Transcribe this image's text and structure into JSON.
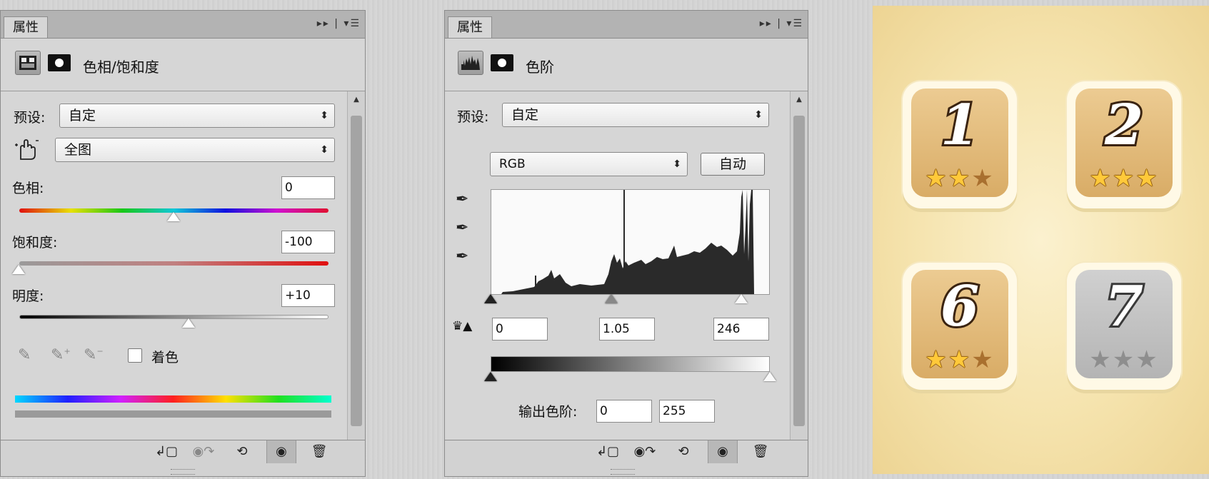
{
  "panel1": {
    "tab_label": "属性",
    "title": "色相/饱和度",
    "preset_label": "预设:",
    "preset_value": "自定",
    "range_value": "全图",
    "hue_label": "色相:",
    "hue_value": "0",
    "saturation_label": "饱和度:",
    "saturation_value": "-100",
    "lightness_label": "明度:",
    "lightness_value": "+10",
    "colorize_label": "着色",
    "colorize_checked": false
  },
  "panel2": {
    "tab_label": "属性",
    "title": "色阶",
    "preset_label": "预设:",
    "preset_value": "自定",
    "channel_value": "RGB",
    "auto_label": "自动",
    "input_black": "0",
    "input_gamma": "1.05",
    "input_white": "246",
    "output_label": "输出色阶:",
    "output_black": "0",
    "output_white": "255"
  },
  "game": {
    "tiles": [
      {
        "number": "1",
        "stars_earned": 2,
        "stars_total": 3,
        "locked": false
      },
      {
        "number": "2",
        "stars_earned": 3,
        "stars_total": 3,
        "locked": false
      },
      {
        "number": "6",
        "stars_earned": 2,
        "stars_total": 3,
        "locked": false
      },
      {
        "number": "7",
        "stars_earned": 0,
        "stars_total": 3,
        "locked": true
      }
    ]
  },
  "icons": {
    "tab_menu": "panel-menu-icon",
    "collapse": "double-arrow-icon",
    "footer": [
      "clip-to-layer-icon",
      "view-previous-icon",
      "reset-icon",
      "visibility-eye-icon",
      "trash-icon"
    ]
  }
}
